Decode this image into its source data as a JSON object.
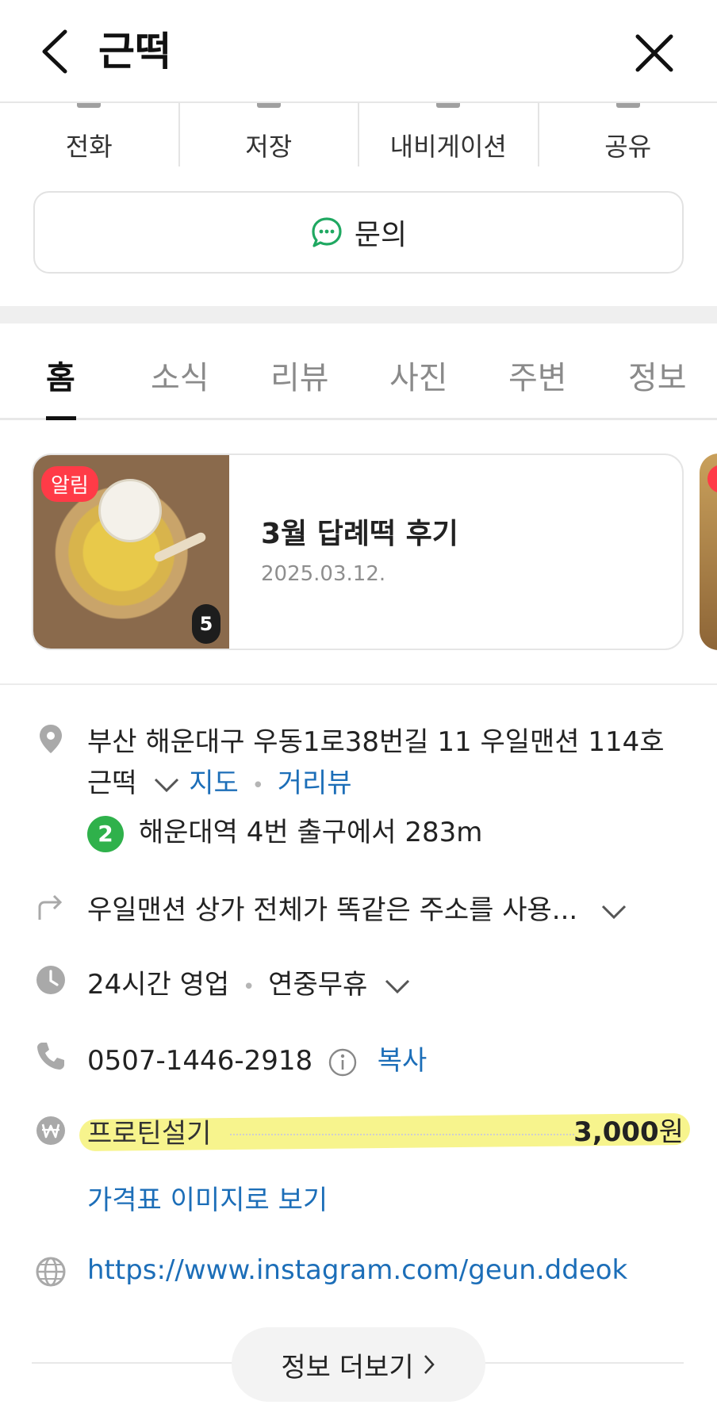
{
  "header": {
    "title": "근떡"
  },
  "actions": [
    {
      "label": "전화"
    },
    {
      "label": "저장"
    },
    {
      "label": "내비게이션"
    },
    {
      "label": "공유"
    }
  ],
  "inquiry": {
    "label": "문의"
  },
  "tabs": [
    {
      "label": "홈",
      "active": true
    },
    {
      "label": "소식"
    },
    {
      "label": "리뷰"
    },
    {
      "label": "사진"
    },
    {
      "label": "주변"
    },
    {
      "label": "정보"
    }
  ],
  "news": {
    "badge": "알림",
    "photo_count": "5",
    "title": "3월 답례떡 후기",
    "date": "2025.03.12."
  },
  "address": {
    "line1": "부산 해운대구 우동1로38번길 11 우일맨션 114호",
    "line2": "근떡",
    "map_link": "지도",
    "street_view_link": "거리뷰",
    "subway_line": "2",
    "subway_text": "해운대역 4번 출구에서 283m"
  },
  "directions": {
    "text": "우일맨션 상가 전체가 똑같은 주소를 사용..."
  },
  "hours": {
    "status": "24시간 영업",
    "holiday": "연중무휴"
  },
  "phone": {
    "number": "0507-1446-2918",
    "copy_label": "복사"
  },
  "menu": {
    "item_name": "프로틴설기",
    "price": "3,000",
    "currency": "원",
    "price_image_link": "가격표 이미지로 보기"
  },
  "website": {
    "url": "https://www.instagram.com/geun.ddeok"
  },
  "more": {
    "label": "정보 더보기"
  },
  "colors": {
    "link": "#1c6eb8",
    "subway_line2": "#2fb14b",
    "alarm_badge": "#ff3b47",
    "highlight": "#f6f279",
    "inquiry_icon": "#1fa861"
  }
}
